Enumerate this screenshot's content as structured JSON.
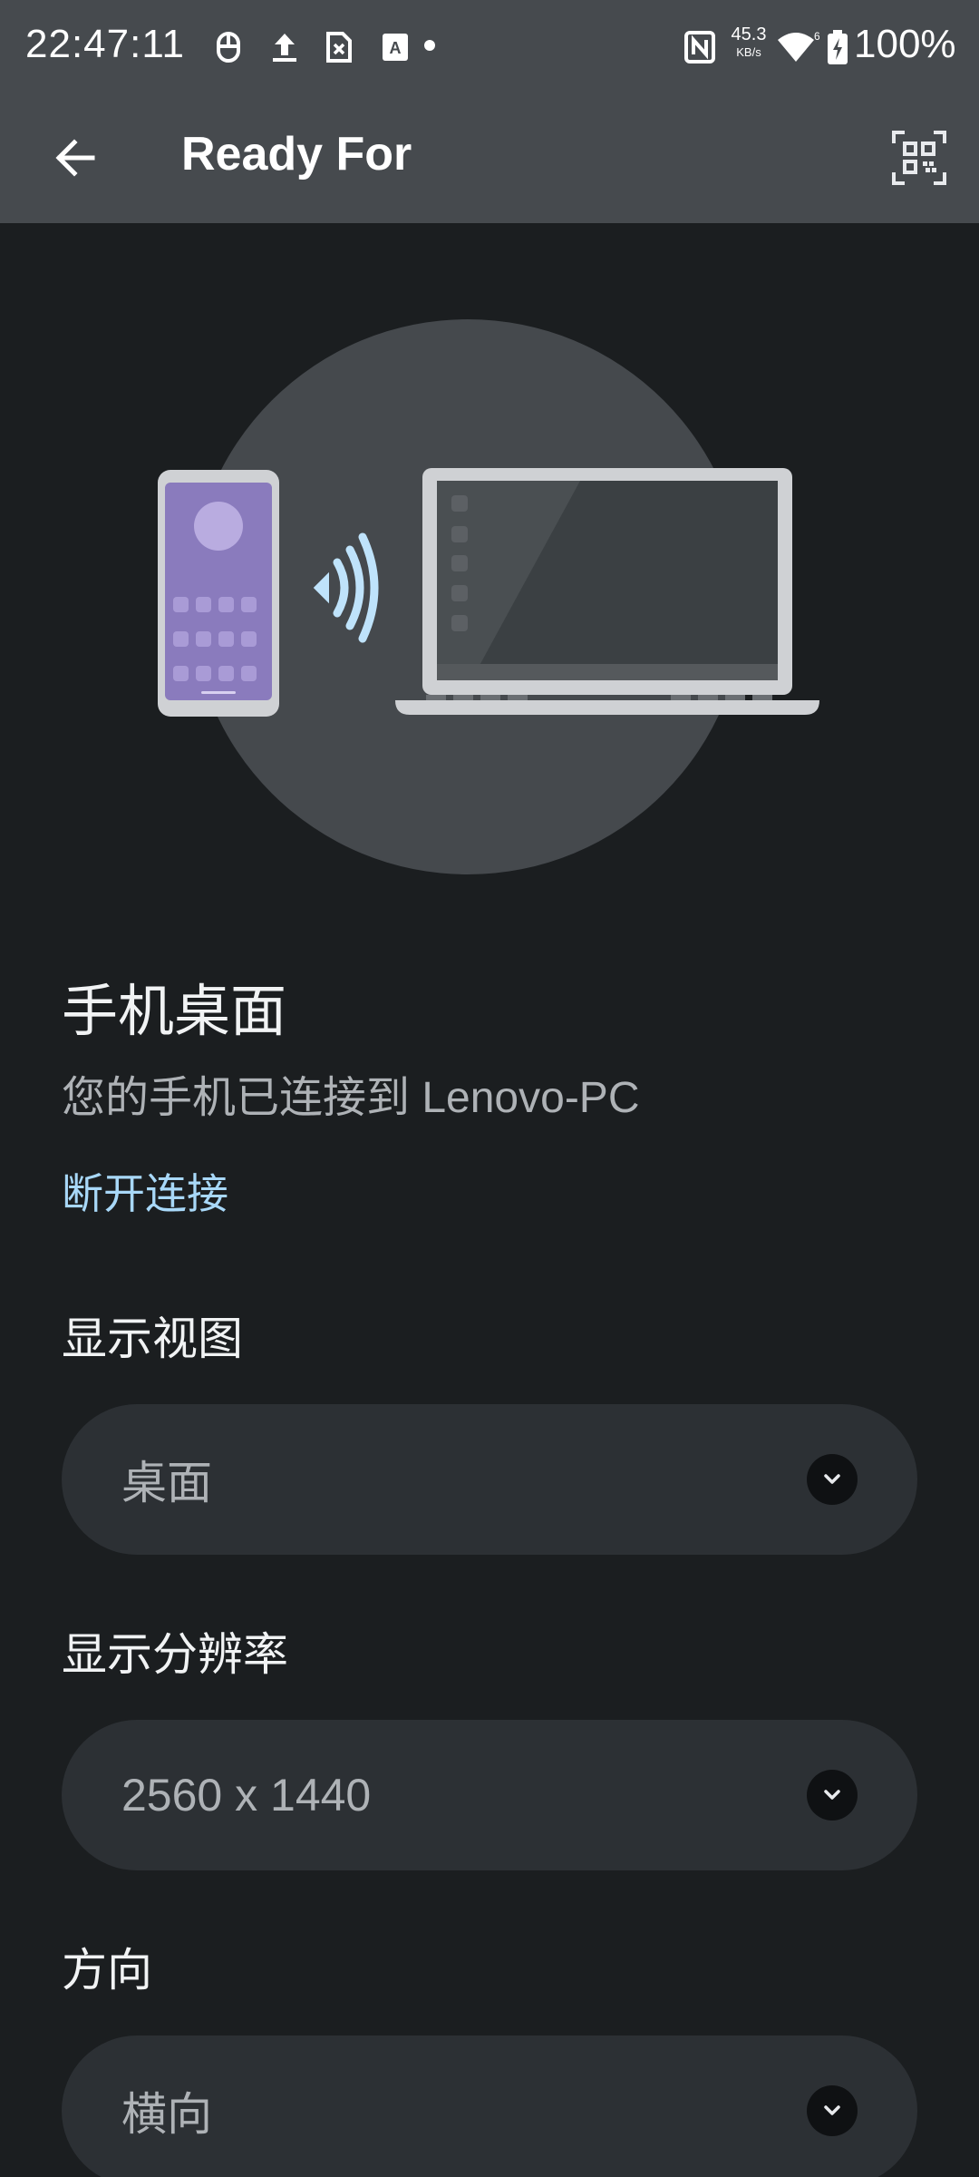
{
  "status_bar": {
    "time": "22:47:11",
    "net_speed_value": "45.3",
    "net_speed_unit": "KB/s",
    "battery": "100%",
    "icons": [
      "mouse-icon",
      "upload-icon",
      "sim-off-icon",
      "keyboard-a-icon",
      "nfc-icon",
      "wifi-6-icon",
      "battery-charging-icon"
    ]
  },
  "app_bar": {
    "title": "Ready For",
    "back_icon": "arrow-back-icon",
    "qr_icon": "qr-scan-icon"
  },
  "connection": {
    "title": "手机桌面",
    "subtitle": "您的手机已连接到 Lenovo-PC",
    "disconnect_label": "断开连接"
  },
  "settings": [
    {
      "label": "显示视图",
      "value": "桌面"
    },
    {
      "label": "显示分辨率",
      "value": "2560 x 1440"
    },
    {
      "label": "方向",
      "value": "横向"
    }
  ],
  "colors": {
    "background": "#1b1e20",
    "bar": "#464a4e",
    "link": "#a8d8f8",
    "dropdown": "#2c3034",
    "phone_screen": "#8877bb"
  }
}
